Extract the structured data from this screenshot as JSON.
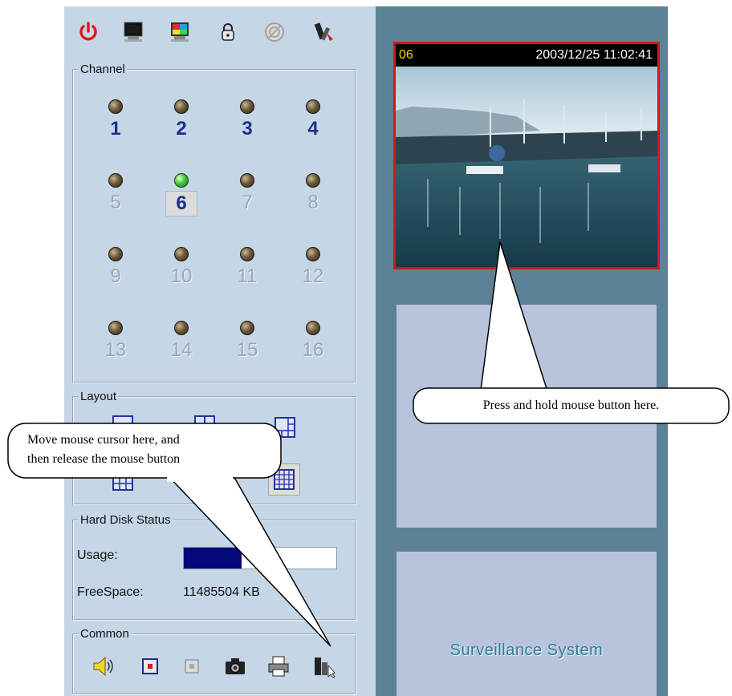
{
  "toolbar": {
    "buttons": [
      {
        "name": "power-icon"
      },
      {
        "name": "monitor-icon"
      },
      {
        "name": "color-settings-icon"
      },
      {
        "name": "lock-icon"
      },
      {
        "name": "disabled-icon"
      },
      {
        "name": "tools-icon"
      }
    ]
  },
  "channel_panel": {
    "title": "Channel",
    "channels": [
      {
        "num": "1",
        "state": "active"
      },
      {
        "num": "2",
        "state": "active"
      },
      {
        "num": "3",
        "state": "active"
      },
      {
        "num": "4",
        "state": "active"
      },
      {
        "num": "5",
        "state": "inactive"
      },
      {
        "num": "6",
        "state": "selected"
      },
      {
        "num": "7",
        "state": "inactive"
      },
      {
        "num": "8",
        "state": "inactive"
      },
      {
        "num": "9",
        "state": "inactive"
      },
      {
        "num": "10",
        "state": "inactive"
      },
      {
        "num": "11",
        "state": "inactive"
      },
      {
        "num": "12",
        "state": "inactive"
      },
      {
        "num": "13",
        "state": "inactive"
      },
      {
        "num": "14",
        "state": "inactive"
      },
      {
        "num": "15",
        "state": "inactive"
      },
      {
        "num": "16",
        "state": "inactive"
      }
    ]
  },
  "layout_panel": {
    "title": "Layout"
  },
  "hard_disk": {
    "title": "Hard Disk Status",
    "usage_label": "Usage:",
    "usage_fraction": 0.38,
    "free_label": "FreeSpace:",
    "free_value": "11485504 KB"
  },
  "common_panel": {
    "title": "Common"
  },
  "video": {
    "channel": "06",
    "timestamp": "2003/12/25 11:02:41"
  },
  "branding": {
    "text": "Surveillance System"
  },
  "callouts": {
    "press_hold": "Press and hold mouse button here.",
    "move_release_line1": "Move mouse cursor here, and",
    "move_release_line2": "then release the mouse button"
  },
  "colors": {
    "panel_bg": "#c5d7e6",
    "right_bg": "#5d8297",
    "active_channel": "#1c2e8e",
    "disk_bar": "#03097a",
    "video_border": "#d4151a"
  }
}
